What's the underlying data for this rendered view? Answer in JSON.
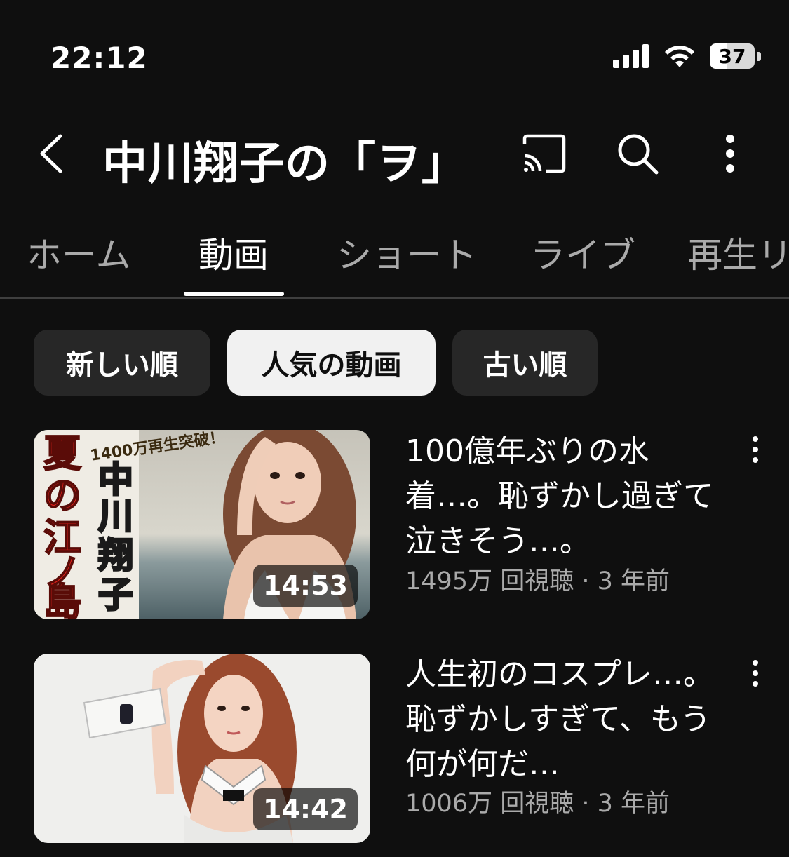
{
  "status_bar": {
    "time": "22:12",
    "battery": "37",
    "icons": [
      "cellular-signal-icon",
      "wifi-icon",
      "battery-icon"
    ]
  },
  "header": {
    "channel_title": "中川翔子の「ヲ」",
    "icons": [
      "back-arrow-icon",
      "cast-icon",
      "search-icon",
      "more-vertical-icon"
    ]
  },
  "tabs": [
    {
      "label": "ホーム"
    },
    {
      "label": "動画"
    },
    {
      "label": "ショート"
    },
    {
      "label": "ライブ"
    },
    {
      "label": "再生リ"
    }
  ],
  "active_tab": "動画",
  "chips": [
    {
      "label": "新しい順"
    },
    {
      "label": "人気の動画"
    },
    {
      "label": "古い順"
    }
  ],
  "selected_chip": "人気の動画",
  "videos": [
    {
      "title": "100億年ぶりの水着…。恥ずかし過ぎて泣きそう…。",
      "views": "1495万 回視聴",
      "age": "3 年前",
      "duration": "14:53",
      "thumbnail_text": {
        "banner": "1400万再生突破！",
        "left_column": "夏の江ノ島",
        "right_column": "中川翔子"
      }
    },
    {
      "title": "人生初のコスプレ…。恥ずかしすぎて、もう何が何だ…",
      "views": "1006万 回視聴",
      "age": "3 年前",
      "duration": "14:42"
    }
  ],
  "colors": {
    "background": "#0f0f0f",
    "chip_bg": "#272727",
    "chip_selected_bg": "#f1f1f1",
    "secondary_text": "#aaaaaa",
    "thumb_red": "#e0201b",
    "thumb_yellow": "#f7e41c"
  }
}
